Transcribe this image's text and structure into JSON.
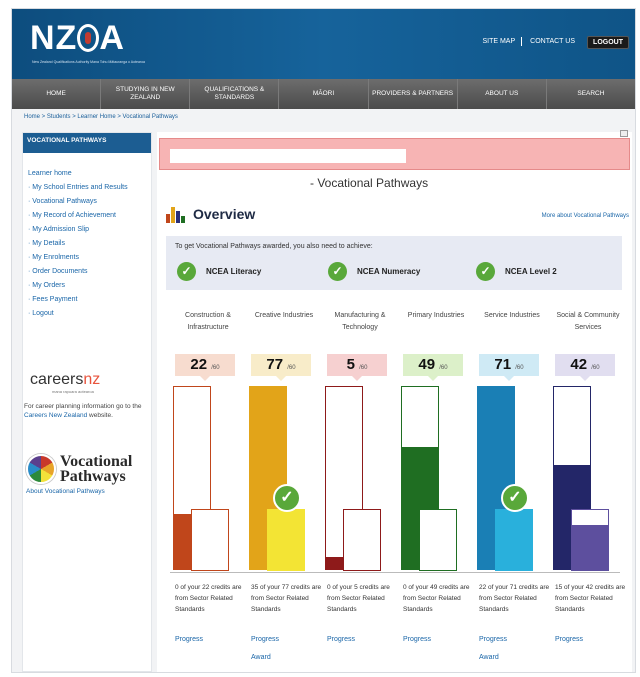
{
  "header": {
    "logo": "NZQA",
    "logo_sub": "New Zealand Qualifications Authority Mana Tohu Mātauranga o Aotearoa",
    "links": [
      "SITE MAP",
      "CONTACT US"
    ],
    "logout": "LOGOUT"
  },
  "nav": [
    "HOME",
    "STUDYING IN NEW ZEALAND",
    "QUALIFICATIONS & STANDARDS",
    "MĀORI",
    "PROVIDERS & PARTNERS",
    "ABOUT US",
    "SEARCH"
  ],
  "breadcrumb": "Home > Students > Learner Home > Vocational Pathways",
  "sidebar": {
    "heading": "VOCATIONAL PATHWAYS",
    "items": [
      "Learner home",
      "· My School Entries and Results",
      "· Vocational Pathways",
      "· My Record of Achievement",
      "· My Admission Slip",
      "· My Details",
      "· My Enrolments",
      "· Order Documents",
      "· My Orders",
      "· Fees Payment",
      "· Logout"
    ],
    "careers_logo": "careers",
    "careers_logo_accent": "nz",
    "careers_sub": "mana rapuara aotearoa",
    "careers_text_a": "For career planning information go to the ",
    "careers_link": "Careers New Zealand",
    "careers_text_b": " website.",
    "vp_logo_line1": "Vocational",
    "vp_logo_line2": "Pathways",
    "vp_about": "About Vocational Pathways"
  },
  "main": {
    "page_title": "- Vocational Pathways",
    "overview_title": "Overview",
    "more_link": "More about Vocational Pathways",
    "req_intro": "To get Vocational Pathways awarded, you also need to achieve:",
    "requirements": [
      "NCEA Literacy",
      "NCEA Numeracy",
      "NCEA Level 2"
    ],
    "check_glyph": "✓"
  },
  "pathways": [
    {
      "name": "Construction & Infrastructure",
      "score": "22",
      "of": "/60",
      "credits": 22,
      "sector_credits": 0,
      "desc": "0 of your 22 credits are from Sector Related Standards",
      "progress": "Progress",
      "award": "",
      "awarded": false,
      "color": "#c0461b",
      "light": "#f7dccf"
    },
    {
      "name": "Creative Industries",
      "score": "77",
      "of": "/60",
      "credits": 77,
      "sector_credits": 35,
      "desc": "35 of your 77 credits are from Sector Related Standards",
      "progress": "Progress",
      "award": "Award",
      "awarded": true,
      "color": "#e2a419",
      "light": "#f8ecc9",
      "color_b": "#f3e434"
    },
    {
      "name": "Manufacturing & Technology",
      "score": "5",
      "of": "/60",
      "credits": 5,
      "sector_credits": 0,
      "desc": "0 of your 5 credits are from Sector Related Standards",
      "progress": "Progress",
      "award": "",
      "awarded": false,
      "color": "#8e1a1a",
      "light": "#f6d0d0"
    },
    {
      "name": "Primary Industries",
      "score": "49",
      "of": "/60",
      "credits": 49,
      "sector_credits": 0,
      "desc": "0 of your 49 credits are from Sector Related Standards",
      "progress": "Progress",
      "award": "",
      "awarded": false,
      "color": "#1f6e22",
      "light": "#dcf0c9"
    },
    {
      "name": "Service Industries",
      "score": "71",
      "of": "/60",
      "credits": 71,
      "sector_credits": 22,
      "desc": "22 of your 71 credits are from Sector Related Standards",
      "progress": "Progress",
      "award": "Award",
      "awarded": true,
      "color": "#1a7fb5",
      "light": "#cfeaf5",
      "color_b": "#29b0dc"
    },
    {
      "name": "Social & Community Services",
      "score": "42",
      "of": "/60",
      "credits": 42,
      "sector_credits": 15,
      "desc": "15 of your 42 credits are from Sector Related Standards",
      "progress": "Progress",
      "award": "",
      "awarded": false,
      "color": "#232668",
      "light": "#e1def0",
      "color_b": "#5d4f9e"
    }
  ]
}
